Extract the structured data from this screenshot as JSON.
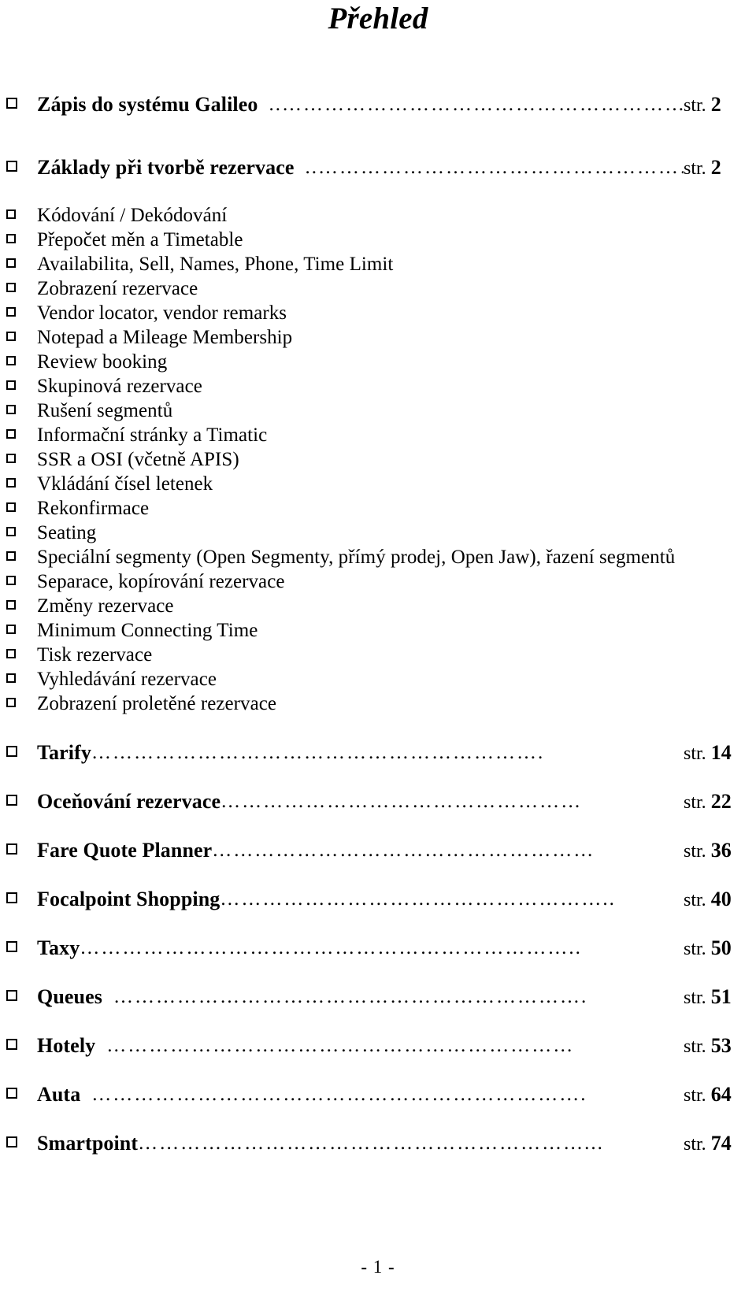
{
  "document": {
    "title": "Přehled",
    "footer_page_marker": "- 1 -",
    "bullet_glyph": "hollow-square",
    "page_label": "str."
  },
  "toc": {
    "page_prefix": "str.",
    "entries": [
      {
        "label": "Zápis do systému Galileo",
        "leader": "..…………………………………………………..",
        "page_prefix": "str.",
        "page": "2",
        "level": "major"
      },
      {
        "label": "Základy při tvorbě rezervace",
        "leader": "..………………………………………………",
        "page_prefix": "str.",
        "page": "2",
        "level": "major"
      }
    ],
    "subentries": [
      "Kódování / Dekódování",
      "Přepočet měn a Timetable",
      "Availabilita, Sell, Names, Phone, Time Limit",
      "Zobrazení rezervace",
      "Vendor locator, vendor remarks",
      "Notepad a Mileage Membership",
      "Review booking",
      "Skupinová rezervace",
      "Rušení segmentů",
      "Informační stránky a Timatic",
      "SSR a OSI (včetně APIS)",
      "Vkládání čísel letenek",
      "Rekonfirmace",
      "Seating",
      "Speciální segmenty (Open Segmenty, přímý prodej, Open Jaw), řazení segmentů",
      "Separace, kopírování rezervace",
      "Změny rezervace",
      "Minimum Connecting Time",
      "Tisk rezervace",
      "Vyhledávání rezervace",
      "Zobrazení proletěné rezervace"
    ],
    "tail_entries": [
      {
        "label": "Tarify",
        "leader": "……………………………………………………….",
        "page_prefix": "str.",
        "page": "14"
      },
      {
        "label": "Oceňování rezervace",
        "leader": "……………………………………………",
        "page_prefix": "str.",
        "page": "22"
      },
      {
        "label": "Fare Quote Planner",
        "leader": "………………………………………………",
        "page_prefix": "str.",
        "page": "36"
      },
      {
        "label": "Focalpoint Shopping",
        "leader": "………………………………………………..",
        "page_prefix": "str.",
        "page": "40"
      },
      {
        "label": "Taxy",
        "leader": "……………………………………………………………..",
        "page_prefix": "str.",
        "page": "50"
      },
      {
        "label": "Queues",
        "leader": "………………………………………………………….",
        "page_prefix": "str.",
        "page": "51"
      },
      {
        "label": "Hotely",
        "leader": "…………………………………………………………",
        "page_prefix": "str.",
        "page": "53"
      },
      {
        "label": "Auta",
        "leader": "…………………………………………………………….",
        "page_prefix": "str.",
        "page": "64"
      },
      {
        "label": "Smartpoint",
        "leader": "………………………………………………………...",
        "page_prefix": "str.",
        "page": "74"
      }
    ]
  }
}
